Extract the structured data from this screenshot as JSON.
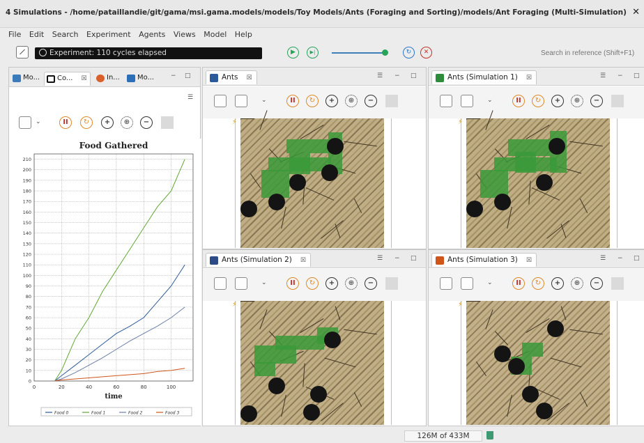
{
  "window": {
    "title": "4 Simulations - /home/pataillandie/git/gama/msi.gama.models/models/Toy Models/Ants (Foraging and Sorting)/models/Ant Foraging (Multi-Simulation).gaml",
    "close": "✕"
  },
  "menu": [
    "File",
    "Edit",
    "Search",
    "Experiment",
    "Agents",
    "Views",
    "Model",
    "Help"
  ],
  "toolbar": {
    "status": "Experiment: 110 cycles elapsed",
    "run_icon": "▶",
    "step_icon": "▶|",
    "reload_icon": "↻",
    "stop_icon": "✕",
    "search_placeholder": "Search in reference (Shift+F1)"
  },
  "left_panel": {
    "tabs": [
      {
        "label": "Mo...",
        "color": "#3b7bb9"
      },
      {
        "label": "Co...",
        "color": "#111111"
      },
      {
        "label": "In...",
        "color": "#d9602a"
      },
      {
        "label": "Mo...",
        "color": "#2a6fb8"
      }
    ],
    "tab_close": "☒"
  },
  "sim_controls": {
    "chevron": "⌄",
    "pause": "II",
    "sync": "↻",
    "zoom_in": "+",
    "zoom_fit": "⊕",
    "zoom_out": "−"
  },
  "views": [
    {
      "title": "Ants",
      "color": "#2b5a9c"
    },
    {
      "title": "Ants (Simulation 1)",
      "color": "#2d8c3c"
    },
    {
      "title": "Ants (Simulation 2)",
      "color": "#2b4a86"
    },
    {
      "title": "Ants (Simulation 3)",
      "color": "#d0551b"
    }
  ],
  "view_tab_close": "☒",
  "view_ctrls": {
    "menu": "☰",
    "minimize": "−",
    "maximize": "□"
  },
  "status_bar": {
    "heap": "126M of 433M"
  },
  "chart_data": {
    "type": "line",
    "title": "Food Gathered",
    "xlabel": "time",
    "ylabel": "",
    "xlim": [
      0,
      116
    ],
    "ylim": [
      0,
      215
    ],
    "x_ticks": [
      0,
      20,
      40,
      60,
      80,
      100
    ],
    "y_ticks": [
      0,
      10,
      20,
      30,
      40,
      50,
      60,
      70,
      80,
      90,
      100,
      110,
      120,
      130,
      140,
      150,
      160,
      170,
      180,
      190,
      200,
      210
    ],
    "grid": true,
    "legend_position": "bottom",
    "series": [
      {
        "name": "Food 0",
        "color": "#2b5a9c",
        "x": [
          15,
          20,
          30,
          40,
          50,
          60,
          70,
          80,
          90,
          100,
          110
        ],
        "values": [
          0,
          5,
          15,
          25,
          35,
          45,
          52,
          60,
          75,
          90,
          110
        ]
      },
      {
        "name": "Food 1",
        "color": "#5fa832",
        "x": [
          15,
          20,
          30,
          40,
          50,
          60,
          70,
          80,
          90,
          100,
          110
        ],
        "values": [
          0,
          10,
          40,
          60,
          85,
          105,
          125,
          145,
          165,
          180,
          210
        ]
      },
      {
        "name": "Food 2",
        "color": "#6c7ea8",
        "x": [
          15,
          20,
          30,
          40,
          50,
          60,
          70,
          80,
          90,
          100,
          110
        ],
        "values": [
          0,
          2,
          8,
          15,
          22,
          30,
          38,
          45,
          52,
          60,
          70
        ]
      },
      {
        "name": "Food 3",
        "color": "#d0551b",
        "x": [
          15,
          20,
          30,
          40,
          50,
          60,
          70,
          80,
          90,
          100,
          110
        ],
        "values": [
          0,
          1,
          2,
          3,
          4,
          5,
          6,
          7,
          9,
          10,
          12
        ]
      }
    ]
  }
}
